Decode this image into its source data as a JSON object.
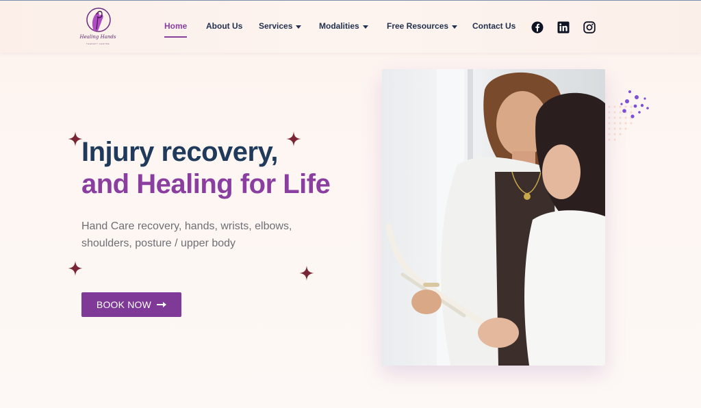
{
  "brand": {
    "logo_text": "Healing Hands",
    "logo_subtext": "THERAPY CENTRE"
  },
  "nav": {
    "items": [
      {
        "label": "Home",
        "active": true,
        "has_dropdown": false
      },
      {
        "label": "About Us",
        "active": false,
        "has_dropdown": false
      },
      {
        "label": "Services",
        "active": false,
        "has_dropdown": true
      },
      {
        "label": "Modalities",
        "active": false,
        "has_dropdown": true
      },
      {
        "label": "Free Resources",
        "active": false,
        "has_dropdown": true
      },
      {
        "label": "Contact Us",
        "active": false,
        "has_dropdown": false
      }
    ],
    "social": [
      {
        "icon": "facebook-icon"
      },
      {
        "icon": "linkedin-icon"
      },
      {
        "icon": "instagram-icon"
      }
    ]
  },
  "hero": {
    "title_line1": "Injury recovery,",
    "title_line2": "and Healing for Life",
    "subtitle": "Hand Care recovery, hands, wrists, elbows, shoulders, posture / upper body",
    "cta_label": "BOOK NOW",
    "cta_icon": "arrow-right-icon"
  },
  "colors": {
    "accent": "#8a3ea0",
    "button": "#7f3a97",
    "heading": "#1f3a5a",
    "sparkle": "#7a2535"
  }
}
